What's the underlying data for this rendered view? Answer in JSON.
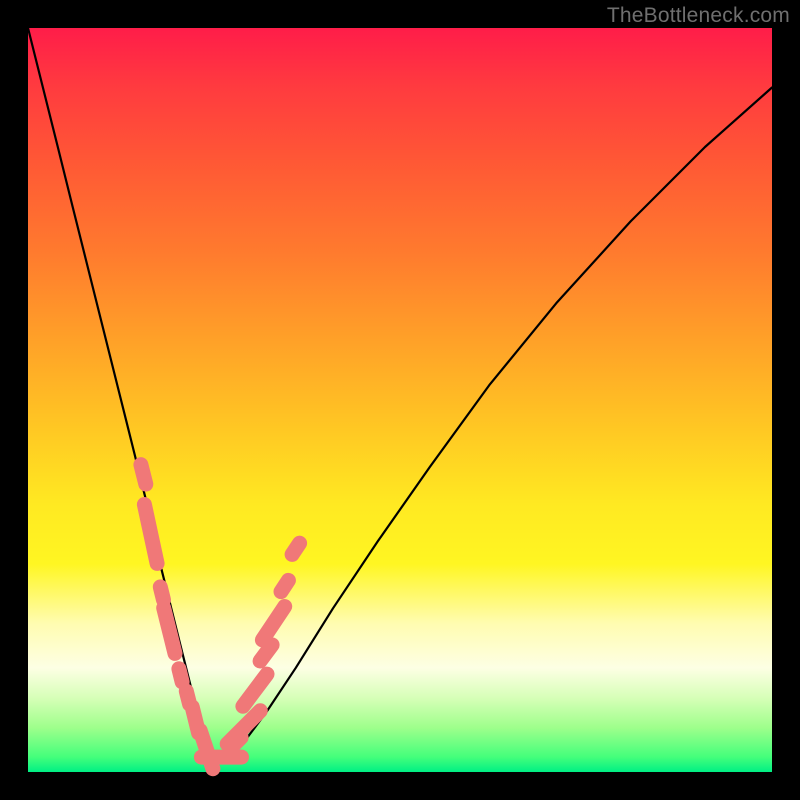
{
  "watermark": "TheBottleneck.com",
  "colors": {
    "marker": "#f07878",
    "curve": "#000000"
  },
  "chart_data": {
    "type": "line",
    "title": "",
    "xlabel": "",
    "ylabel": "",
    "xlim": [
      0,
      100
    ],
    "ylim": [
      0,
      100
    ],
    "grid": false,
    "series": [
      {
        "name": "bottleneck-curve",
        "x": [
          0,
          2,
          4,
          6,
          8,
          10,
          12,
          14,
          16,
          17.5,
          19,
          20.5,
          22,
          23,
          24,
          25,
          27,
          29,
          32,
          36,
          41,
          47,
          54,
          62,
          71,
          81,
          91,
          100
        ],
        "y": [
          100,
          92,
          84,
          76,
          68,
          60,
          52,
          44,
          36,
          29,
          23,
          17,
          11,
          7,
          4,
          2,
          2,
          4,
          8,
          14,
          22,
          31,
          41,
          52,
          63,
          74,
          84,
          92
        ]
      }
    ],
    "markers": {
      "name": "highlighted-points",
      "shape": "capsule",
      "color": "#f07878",
      "points": [
        {
          "x": 15.5,
          "y": 40,
          "len": 3
        },
        {
          "x": 16.5,
          "y": 32,
          "len": 9
        },
        {
          "x": 18.0,
          "y": 24,
          "len": 2
        },
        {
          "x": 19.0,
          "y": 19,
          "len": 7
        },
        {
          "x": 20.5,
          "y": 13,
          "len": 2
        },
        {
          "x": 21.5,
          "y": 10,
          "len": 2
        },
        {
          "x": 22.5,
          "y": 7,
          "len": 4
        },
        {
          "x": 24.0,
          "y": 3,
          "len": 6
        },
        {
          "x": 26.0,
          "y": 2,
          "len": 6
        },
        {
          "x": 28.0,
          "y": 4,
          "len": 2
        },
        {
          "x": 29.0,
          "y": 6,
          "len": 7
        },
        {
          "x": 30.5,
          "y": 11,
          "len": 6
        },
        {
          "x": 32.0,
          "y": 16,
          "len": 3
        },
        {
          "x": 33.0,
          "y": 20,
          "len": 6
        },
        {
          "x": 34.5,
          "y": 25,
          "len": 2
        },
        {
          "x": 36.0,
          "y": 30,
          "len": 2
        }
      ]
    }
  }
}
